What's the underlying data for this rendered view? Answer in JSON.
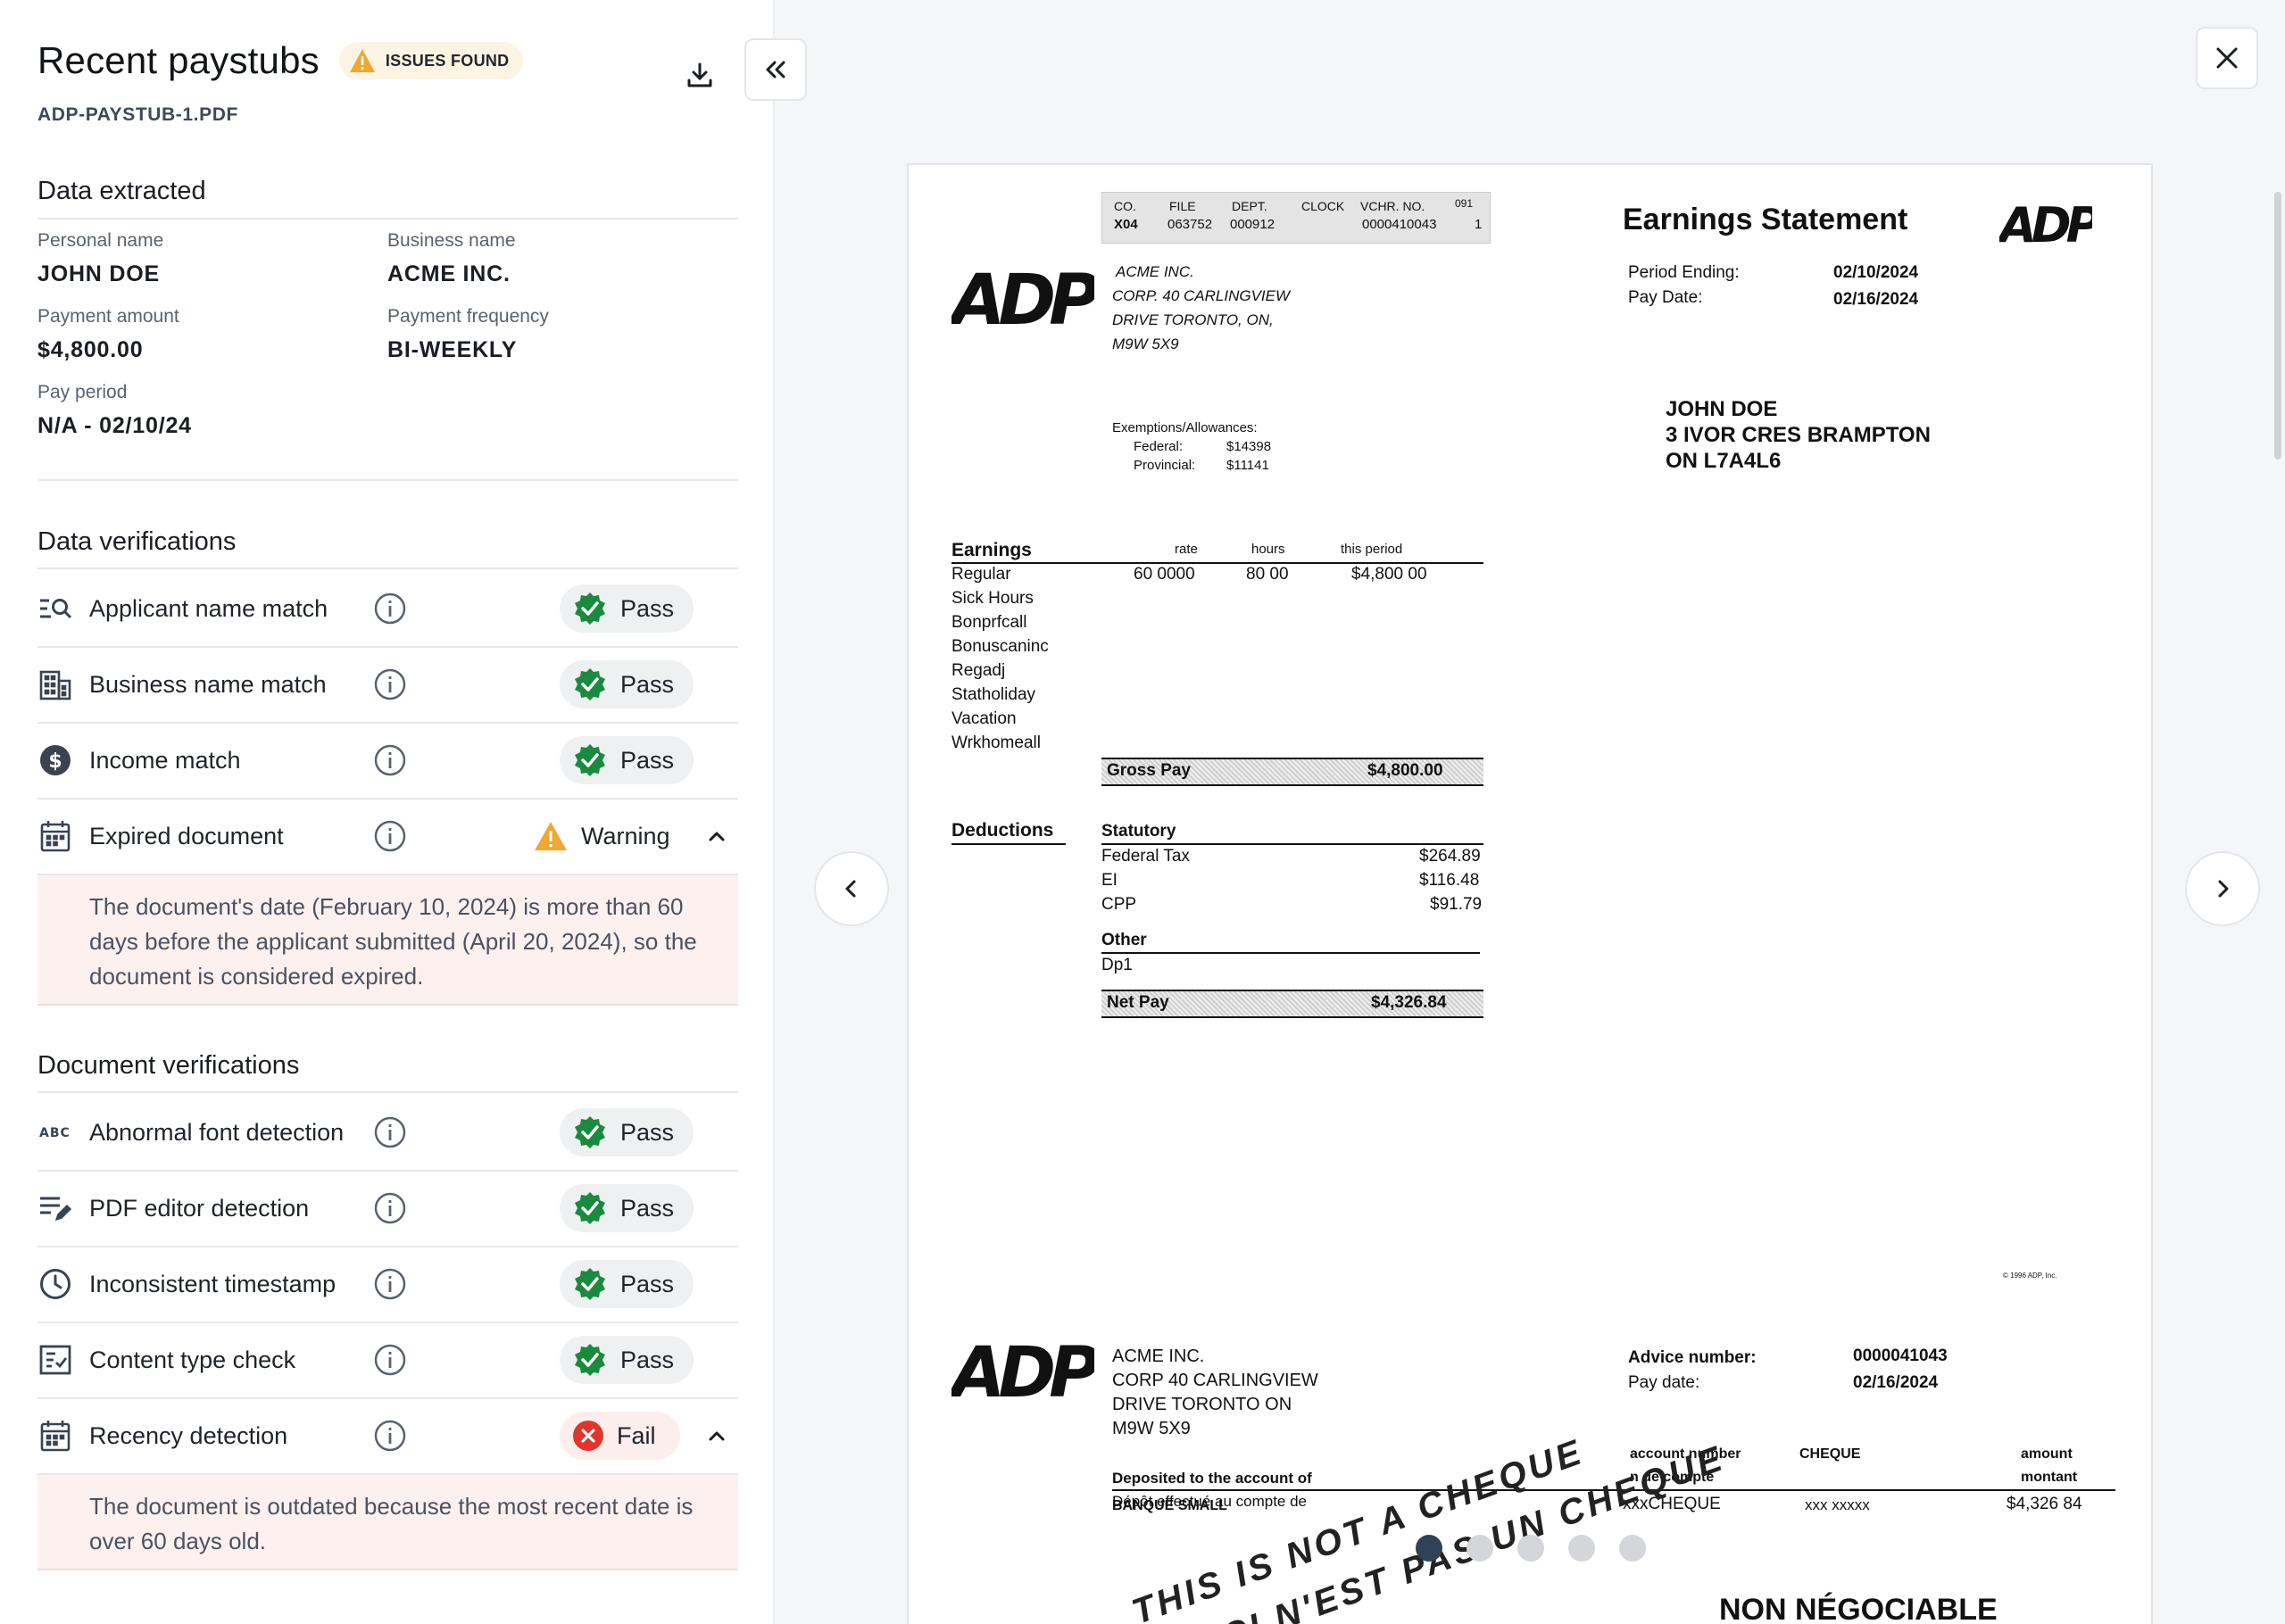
{
  "header": {
    "title": "Recent paystubs",
    "badge": "ISSUES FOUND",
    "filename": "ADP-PAYSTUB-1.PDF"
  },
  "extracted": {
    "title": "Data extracted",
    "fields": [
      {
        "label": "Personal name",
        "value": "JOHN DOE"
      },
      {
        "label": "Business name",
        "value": "ACME INC."
      },
      {
        "label": "Payment amount",
        "value": "$4,800.00"
      },
      {
        "label": "Payment frequency",
        "value": "BI-WEEKLY"
      },
      {
        "label": "Pay period",
        "value": "N/A - 02/10/24"
      }
    ]
  },
  "data_verifications": {
    "title": "Data verifications",
    "items": [
      {
        "label": "Applicant name match",
        "status": "Pass",
        "icon": "search-list-icon"
      },
      {
        "label": "Business name match",
        "status": "Pass",
        "icon": "building-icon"
      },
      {
        "label": "Income match",
        "status": "Pass",
        "icon": "dollar-circle-icon"
      },
      {
        "label": "Expired document",
        "status": "Warning",
        "icon": "calendar-icon",
        "detail": "The document's date (February 10, 2024) is more than 60 days before the applicant submitted (April 20, 2024), so the document is considered expired."
      }
    ]
  },
  "document_verifications": {
    "title": "Document verifications",
    "items": [
      {
        "label": "Abnormal font detection",
        "status": "Pass",
        "icon": "abc-icon"
      },
      {
        "label": "PDF editor detection",
        "status": "Pass",
        "icon": "edit-lines-icon"
      },
      {
        "label": "Inconsistent timestamp",
        "status": "Pass",
        "icon": "clock-icon"
      },
      {
        "label": "Content type check",
        "status": "Pass",
        "icon": "checklist-icon"
      },
      {
        "label": "Recency detection",
        "status": "Fail",
        "icon": "calendar-icon",
        "detail": "The document is outdated because the most recent date is over 60 days old."
      }
    ]
  },
  "document": {
    "header_table": {
      "labels": [
        "CO.",
        "FILE",
        "DEPT.",
        "CLOCK",
        "VCHR.  NO.",
        "091"
      ],
      "values": [
        "X04",
        "063752",
        "000912",
        "",
        "0000410043",
        "1"
      ]
    },
    "statement_title": "Earnings  Statement",
    "company_lines": [
      "ACME INC.",
      "CORP. 40  CARLINGVIEW",
      "DRIVE TORONTO,    ON,",
      "M9W  5X9"
    ],
    "period_ending_label": "Period  Ending:",
    "period_ending": "02/10/2024",
    "pay_date_label": "Pay  Date:",
    "pay_date": "02/16/2024",
    "employee_lines": [
      "JOHN DOE",
      "3 IVOR CRES BRAMPTON",
      "ON  L7A4L6"
    ],
    "exemptions": {
      "title": "Exemptions/Allowances:",
      "federal_label": "Federal:",
      "federal": "$14398",
      "provincial_label": "Provincial:",
      "provincial": "$11141"
    },
    "earnings": {
      "title": "Earnings",
      "col_rate": "rate",
      "col_hours": "hours",
      "col_period": "this   period",
      "rows": [
        "Regular",
        "Sick  Hours",
        "Bonprfcall",
        "Bonuscaninc",
        "Regadj",
        "Statholiday",
        "Vacation",
        "Wrkhomeall"
      ],
      "regular_rate": "60  0000",
      "regular_hours": "80  00",
      "regular_amount": "$4,800  00",
      "gross_label": "Gross  Pay",
      "gross_value": "$4,800.00"
    },
    "deductions": {
      "title": "Deductions",
      "statutory": "Statutory",
      "rows": [
        {
          "label": "Federal  Tax",
          "value": "$264.89"
        },
        {
          "label": "EI",
          "value": "$116.48"
        },
        {
          "label": "CPP",
          "value": "$91.79"
        }
      ],
      "other": "Other",
      "other_row": "Dp1",
      "net_label": "Net  Pay",
      "net_value": "$4,326.84"
    },
    "copyright": "© 1996  ADP,  Inc.",
    "advice": {
      "company_lines": [
        "ACME INC.",
        "CORP 40  CARLINGVIEW",
        "DRIVE TORONTO    ON",
        "M9W  5X9"
      ],
      "advice_label": "Advice  number:",
      "advice_number": "0000041043",
      "pay_date_label": "Pay  date:",
      "pay_date": "02/16/2024",
      "deposited_label": "Deposited    to the account    of",
      "depot_label": "Dépôt  effectué  au  compte   de",
      "account_name": "BANQUE  SMALL",
      "account_number_label": "account  number",
      "account_number_label_fr": "n  de  compte",
      "cheque_label": "CHEQUE",
      "amount_label": "amount",
      "amount_label_fr": "montant",
      "account_value": "xxxCHEQUE",
      "masked": "xxx   xxxxx",
      "amount_value": "$4,326  84",
      "watermark_en": "THIS IS NOT A CHEQUE",
      "watermark_fr": "CECI N'EST PAS UN CHEQUE",
      "non_negotiable": "NON  NÉGOCIABLE"
    }
  },
  "pager": {
    "count": 5,
    "active": 0
  }
}
